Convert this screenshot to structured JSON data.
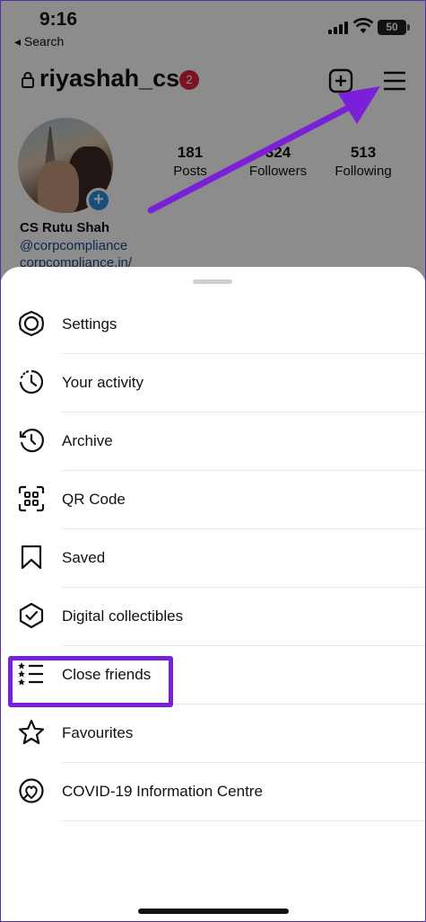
{
  "status_bar": {
    "time": "9:16",
    "back_label": "◂ Search",
    "battery": "50"
  },
  "profile": {
    "username": "riyashah_cs",
    "notification_count": "2",
    "stats": [
      {
        "value": "181",
        "label": "Posts"
      },
      {
        "value": "324",
        "label": "Followers"
      },
      {
        "value": "513",
        "label": "Following"
      }
    ],
    "display_name": "CS Rutu Shah",
    "handle": "@corpcompliance",
    "link": "corpcompliance.in/"
  },
  "menu": {
    "items": [
      {
        "label": "Settings",
        "icon": "settings-gear-icon"
      },
      {
        "label": "Your activity",
        "icon": "activity-clock-icon"
      },
      {
        "label": "Archive",
        "icon": "archive-history-icon"
      },
      {
        "label": "QR Code",
        "icon": "qr-code-icon"
      },
      {
        "label": "Saved",
        "icon": "bookmark-icon"
      },
      {
        "label": "Digital collectibles",
        "icon": "shield-check-icon"
      },
      {
        "label": "Close friends",
        "icon": "close-friends-list-icon"
      },
      {
        "label": "Favourites",
        "icon": "star-icon"
      },
      {
        "label": "COVID-19 Information Centre",
        "icon": "covid-info-icon"
      }
    ]
  },
  "colors": {
    "highlight": "#7a20d8",
    "arrow": "#7a20d8",
    "notification_badge": "#e0233f",
    "add_story": "#2b8fe0"
  }
}
